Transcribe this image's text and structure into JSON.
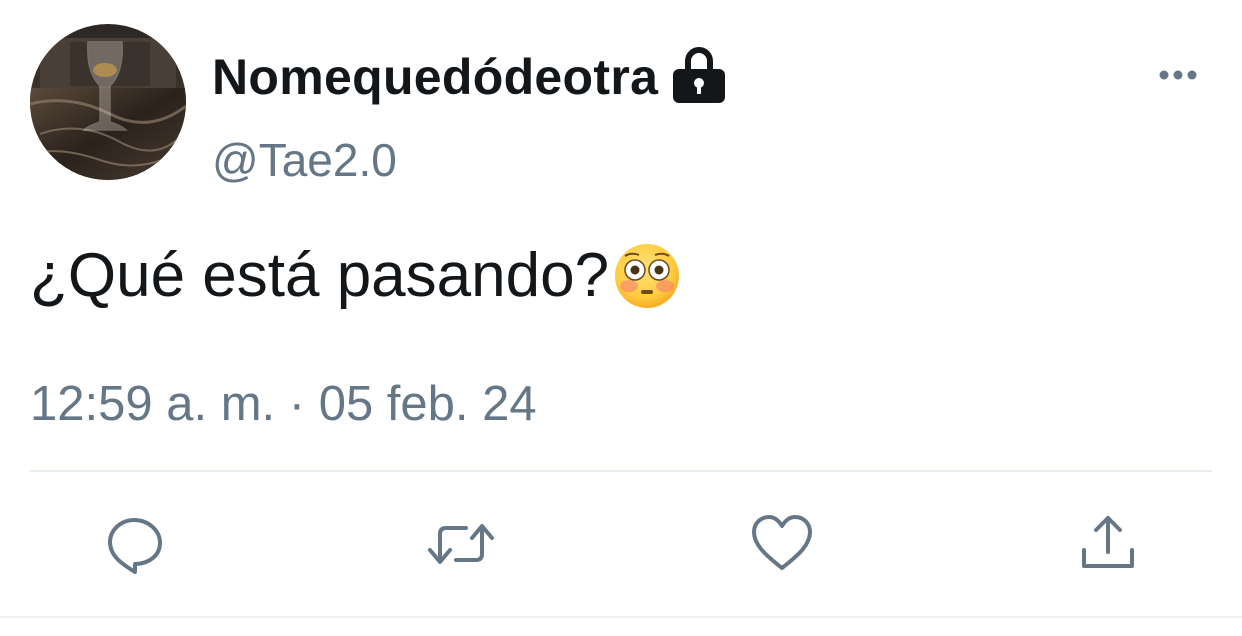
{
  "tweet": {
    "display_name": "Nomequedódeotra",
    "handle": "@Tae2.0",
    "text": "¿Qué está pasando?",
    "timestamp": "12:59 a. m. · 05 feb. 24",
    "protected": true
  },
  "icons": {
    "lock": "lock-icon",
    "more": "more-options-icon",
    "emoji": "flushed-face-emoji",
    "reply": "reply-icon",
    "retweet": "retweet-icon",
    "like": "heart-icon",
    "share": "share-icon"
  },
  "colors": {
    "text_primary": "#14171a",
    "text_secondary": "#657786",
    "divider": "#e6ecf0"
  }
}
